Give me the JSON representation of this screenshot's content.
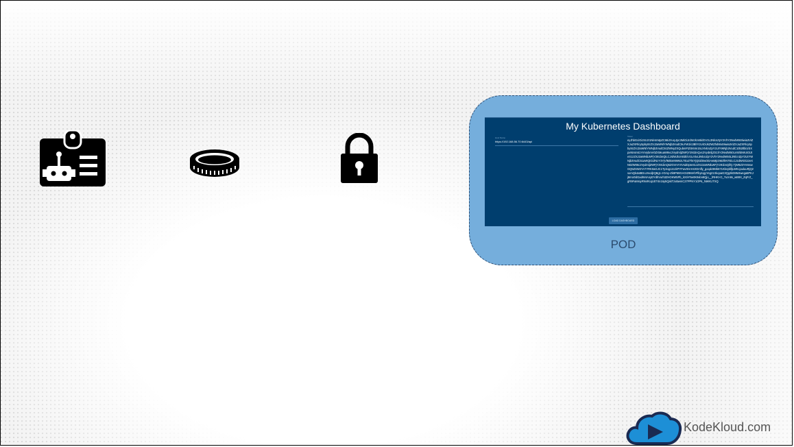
{
  "icons": {
    "id_badge": "id-badge-robot-icon",
    "coin": "coin-icon",
    "lock": "padlock-icon"
  },
  "pod": {
    "label": "POD",
    "dashboard": {
      "title": "My Kubernetes Dashboard",
      "url_label": "Host Name",
      "url_value": "https://192.168.56.70:6443/api",
      "token_label": "Token",
      "token_value": "eyJhbGciOiJSUzI1NiIsImtpZCI6IiJ9.eyJpc3MiOiJrdWJlcm5ldGVzL3NlcnZpY2VhY2NvdW50Iiwia3ViZXJuZXRlcy5pby9zZXJ2aWNlYWNjb3VudC9uYW1lc3BhY2UiOiJkZWZhdWx0Iiwia3ViZXJuZXRlcy5pby9zZXJ2aWNlYWNjb3VudC9zZWNyZXQubmFtZSI6Im15LXNlcnZpY2UtYWNjb3VudC10b2tlbi1rbXpxNiIsImt1YmVybmV0ZXMuaW8vc2VydmljZWFjY291bnQvc2VydmljZS1hY2NvdW50Lm5hbWUiOiJteS1zZXJ2aWNlLWFjY291bnQiLCJrdWJlcm5ldGVzLmlvL3NlcnZpY2VhY2NvdW50L3NlcnZpY2UtYWNjb3VudC51aWQiOiJlNzY3YjVlMi0xMWMzLTExZTktYjQ0Zi0wODAwMjc0MzlhNTEiLCJzdWIiOiJzeXN0ZW06c2VydmljZWFjY291bnQ6ZGVmYXVsdDpteS1zZXJ2aWNlLWFjY291bnQifQ.TjWBZ3Ym5swGQ5ZSW2YA7YRK0aGJC1Ty3og12czkPYFwvXHAHzIDmfly_goqdc9Mb671KbvyklfjLWKcjouluuRjQ2somQk4atBDoJmcdjtQBg1-zGmy-Zk9P69GAGI29MAhFfkytogyYeg21XkqoaG3Qg2kD8M4wega5PKJj8mU0dGadW4AnyDYdhVurh3ZHOKW5Pb_kXtl-F5e0K9xbn8Qjo__lRHKt-O_7uzn8s_wB9X_ZqFrZ_gR9FaMsiyRNsRcqU07Xn16y5QskTzxBwmC27PPNY1OP6_NWKUTXQ",
      "button_label": "LOAD DASHBOARD"
    }
  },
  "brand": {
    "name": "KodeKloud.com",
    "logo": "kodekloud-cloud-play-icon"
  },
  "colors": {
    "pod_fill": "#75aedc",
    "pod_border": "#2c4d73",
    "dashboard_bg": "#003e6e",
    "logo_blue": "#1d8fd6",
    "logo_navy": "#1a2a52"
  }
}
